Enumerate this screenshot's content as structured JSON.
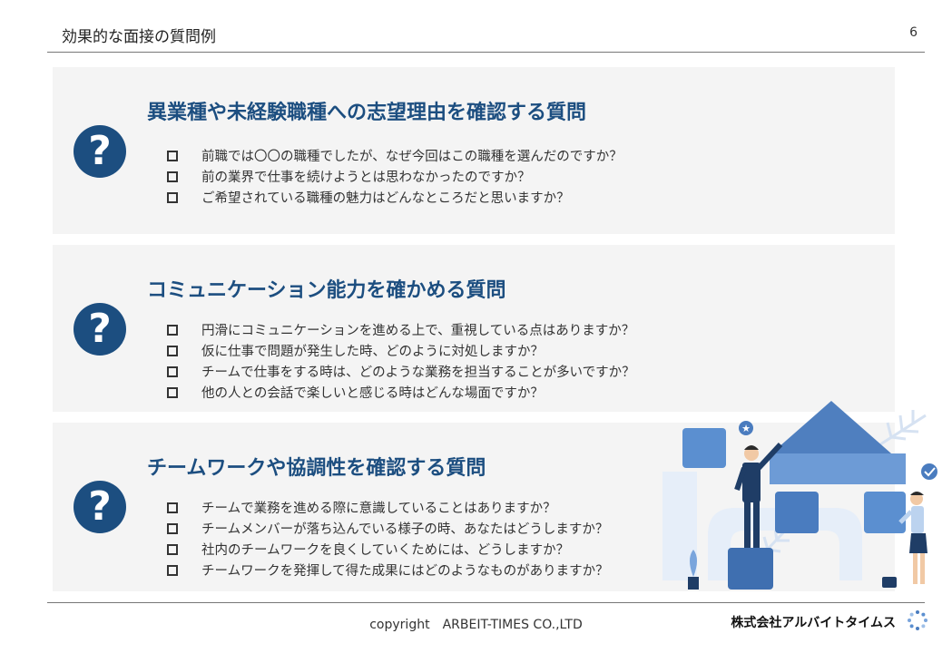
{
  "header": {
    "title": "効果的な面接の質問例",
    "page_number": "6"
  },
  "sections": [
    {
      "heading": "異業種や未経験職種への志望理由を確認する質問",
      "questions": [
        "前職では〇〇の職種でしたが、なぜ今回はこの職種を選んだのですか？",
        "前の業界で仕事を続けようとは思わなかったのですか？",
        "ご希望されている職種の魅力はどんなところだと思いますか？"
      ]
    },
    {
      "heading": "コミュニケーション能力を確かめる質問",
      "questions": [
        "円滑にコミュニケーションを進める上で、重視している点はありますか？",
        "仮に仕事で問題が発生した時、どのように対処しますか？",
        "チームで仕事をする時は、どのような業務を担当することが多いですか？",
        "他の人との会話で楽しいと感じる時はどんな場面ですか？"
      ]
    },
    {
      "heading": "チームワークや協調性を確認する質問",
      "questions": [
        "チームで業務を進める際に意識していることはありますか？",
        "チームメンバーが落ち込んでいる様子の時、あなたはどうしますか？",
        "社内のチームワークを良くしていくためには、どうしますか？",
        "チームワークを発揮して得た成果にはどのようなものがありますか？"
      ]
    }
  ],
  "icons": {
    "question": "?",
    "question_icon_name": "question-mark-icon",
    "bullet_icon_name": "square-bullet-icon"
  },
  "footer": {
    "copyright": "copyright　ARBEIT-TIMES CO.,LTD",
    "brand": "株式会社アルバイトタイムス"
  },
  "colors": {
    "accent": "#1c4e80",
    "card_background": "#f4f4f4",
    "illustration_blue": "#5b8fd0"
  }
}
